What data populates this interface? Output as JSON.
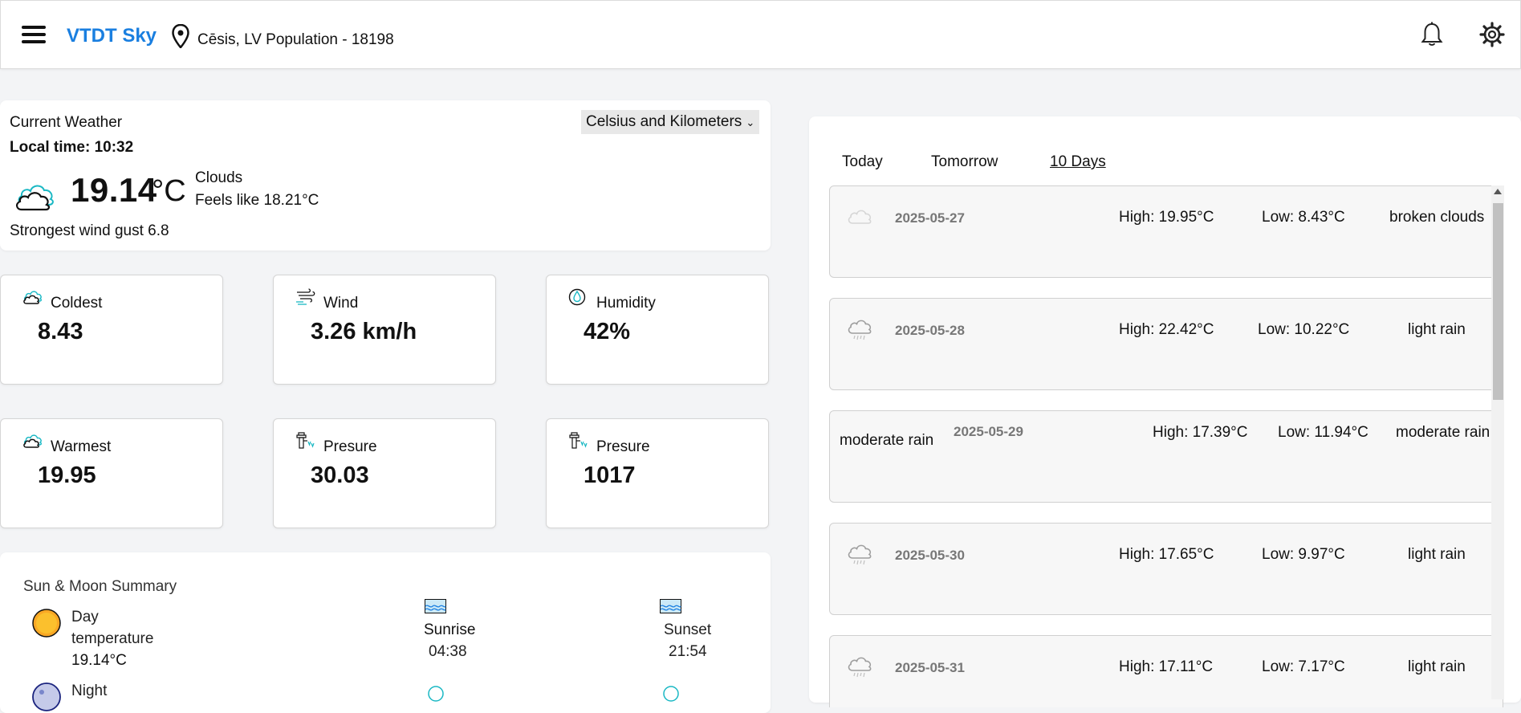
{
  "header": {
    "brand": "VTDT Sky",
    "location": "Cēsis, LV Population - 18198"
  },
  "current": {
    "title": "Current Weather",
    "local_time": "Local time: 10:32",
    "temp": "19.14",
    "unit": "°C",
    "description": "Clouds",
    "feels_like": "Feels like 18.21°C",
    "gust": "Strongest wind gust 6.8",
    "unit_select": "Celsius and Kilometers"
  },
  "tiles": [
    {
      "label": "Coldest",
      "value": "8.43",
      "icon": "cloud-icon"
    },
    {
      "label": "Wind",
      "value": "3.26 km/h",
      "icon": "wind-icon"
    },
    {
      "label": "Humidity",
      "value": "42%",
      "icon": "humidity-icon"
    },
    {
      "label": "Warmest",
      "value": "19.95",
      "icon": "cloud-icon"
    },
    {
      "label": "Presure",
      "value": "30.03",
      "icon": "pressure-icon"
    },
    {
      "label": "Presure",
      "value": "1017",
      "icon": "pressure-icon"
    }
  ],
  "sunmoon": {
    "title": "Sun & Moon Summary",
    "day_line1": "Day",
    "day_line2": "temperature",
    "day_temp": "19.14°C",
    "sunrise_label": "Sunrise",
    "sunrise_time": "04:38",
    "sunset_label": "Sunset",
    "sunset_time": "21:54",
    "night_line1": "Night"
  },
  "forecast": {
    "tabs": [
      "Today",
      "Tomorrow",
      "10 Days"
    ],
    "active_tab": "10 Days",
    "rows": [
      {
        "icon": "cloud-icon",
        "date": "2025-05-27",
        "high": "High: 19.95°C",
        "low": "Low: 8.43°C",
        "desc": "broken clouds"
      },
      {
        "icon": "rain-cloud-icon",
        "date": "2025-05-28",
        "high": "High: 22.42°C",
        "low": "Low: 10.22°C",
        "desc": "light rain"
      },
      {
        "icon_text": "moderate rain",
        "date": "2025-05-29",
        "high": "High: 17.39°C",
        "low": "Low: 11.94°C",
        "desc": "moderate rain"
      },
      {
        "icon": "rain-cloud-icon",
        "date": "2025-05-30",
        "high": "High: 17.65°C",
        "low": "Low: 9.97°C",
        "desc": "light rain"
      },
      {
        "icon": "rain-cloud-icon",
        "date": "2025-05-31",
        "high": "High: 17.11°C",
        "low": "Low: 7.17°C",
        "desc": "light rain"
      }
    ]
  },
  "colors": {
    "brand": "#1a7fe0",
    "background": "#f3f4f6",
    "card": "#ffffff",
    "row_bg": "#f7f7f7",
    "date_text": "#777777"
  }
}
